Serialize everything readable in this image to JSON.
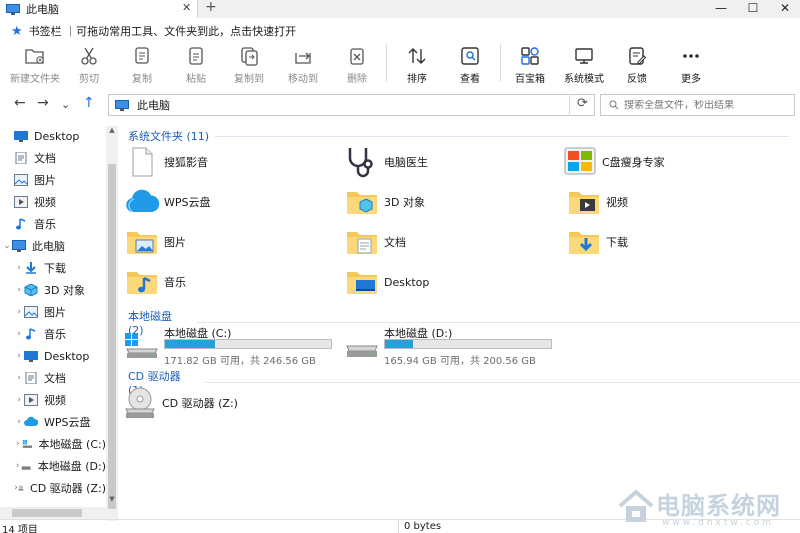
{
  "window": {
    "tab_title": "此电脑",
    "new_tab": "+",
    "minimize": "—",
    "maximize": "☐",
    "close": "✕"
  },
  "bookmark_bar": {
    "text": "书签栏 ｜可拖动常用工具、文件夹到此，点击快速打开"
  },
  "toolbar": {
    "items": [
      {
        "label": "新建文件夹",
        "icon": "new-folder-icon",
        "disabled": true
      },
      {
        "label": "剪切",
        "icon": "scissors-icon",
        "disabled": true
      },
      {
        "label": "复制",
        "icon": "copy-icon",
        "disabled": true
      },
      {
        "label": "粘贴",
        "icon": "paste-icon",
        "disabled": true
      },
      {
        "label": "复制到",
        "icon": "copy-to-icon",
        "disabled": true
      },
      {
        "label": "移动到",
        "icon": "move-to-icon",
        "disabled": true
      },
      {
        "label": "删除",
        "icon": "delete-icon",
        "disabled": true
      },
      {
        "label": "排序",
        "icon": "sort-icon",
        "disabled": false
      },
      {
        "label": "查看",
        "icon": "view-icon",
        "disabled": false
      },
      {
        "label": "百宝箱",
        "icon": "toolbox-icon",
        "disabled": false
      },
      {
        "label": "系统模式",
        "icon": "monitor-icon",
        "disabled": false
      },
      {
        "label": "反馈",
        "icon": "feedback-icon",
        "disabled": false
      },
      {
        "label": "更多",
        "icon": "more-icon",
        "disabled": false
      }
    ]
  },
  "address": {
    "path": "此电脑",
    "search_placeholder": "搜索全盘文件，秒出结果"
  },
  "sidebar": {
    "items": [
      {
        "label": "Desktop",
        "icon": "desktop-icon"
      },
      {
        "label": "文档",
        "icon": "document-icon"
      },
      {
        "label": "图片",
        "icon": "pictures-icon"
      },
      {
        "label": "视频",
        "icon": "video-icon"
      },
      {
        "label": "音乐",
        "icon": "music-icon"
      },
      {
        "label": "此电脑",
        "icon": "this-pc-icon"
      },
      {
        "label": "下载",
        "icon": "download-icon"
      },
      {
        "label": "3D 对象",
        "icon": "3d-objects-icon"
      },
      {
        "label": "图片",
        "icon": "pictures-icon"
      },
      {
        "label": "音乐",
        "icon": "music-icon"
      },
      {
        "label": "Desktop",
        "icon": "desktop-icon"
      },
      {
        "label": "文档",
        "icon": "document-icon"
      },
      {
        "label": "视频",
        "icon": "video-icon"
      },
      {
        "label": "WPS云盘",
        "icon": "wps-cloud-icon"
      },
      {
        "label": "本地磁盘 (C:)",
        "icon": "drive-icon"
      },
      {
        "label": "本地磁盘 (D:)",
        "icon": "drive-icon"
      },
      {
        "label": "CD 驱动器 (Z:)",
        "icon": "cd-drive-icon"
      }
    ]
  },
  "groups": {
    "folders": "系统文件夹 (11)",
    "drives": "本地磁盘 (2)",
    "cd": "CD 驱动器 (1)"
  },
  "folders": [
    {
      "label": "搜狐影音",
      "icon": "file-icon"
    },
    {
      "label": "电脑医生",
      "icon": "stethoscope-icon"
    },
    {
      "label": "C盘瘦身专家",
      "icon": "disk-cleanup-icon"
    },
    {
      "label": "WPS云盘",
      "icon": "wps-cloud-icon"
    },
    {
      "label": "3D 对象",
      "icon": "3d-objects-folder-icon"
    },
    {
      "label": "视频",
      "icon": "video-folder-icon"
    },
    {
      "label": "图片",
      "icon": "pictures-folder-icon"
    },
    {
      "label": "文档",
      "icon": "documents-folder-icon"
    },
    {
      "label": "下载",
      "icon": "downloads-folder-icon"
    },
    {
      "label": "音乐",
      "icon": "music-folder-icon"
    },
    {
      "label": "Desktop",
      "icon": "desktop-folder-icon"
    }
  ],
  "drives": [
    {
      "name": "本地磁盘 (C:)",
      "info": "171.82 GB 可用，共 246.56 GB",
      "used_fraction": 0.3,
      "icon": "windows-drive-icon"
    },
    {
      "name": "本地磁盘 (D:)",
      "info": "165.94 GB 可用，共 200.56 GB",
      "used_fraction": 0.17,
      "icon": "drive-icon"
    }
  ],
  "cd_drive": {
    "name": "CD 驱动器 (Z:)",
    "icon": "cd-drive-icon"
  },
  "status": {
    "count": "14 项目",
    "size": "0 bytes"
  },
  "watermark": {
    "title": "电脑系统网",
    "url": "www.dnxtw.com"
  },
  "colors": {
    "accent": "#1f6fe0",
    "drive_fill": "#26a0da",
    "group_header": "#1e5eb4",
    "folder": "#f4c85b"
  }
}
